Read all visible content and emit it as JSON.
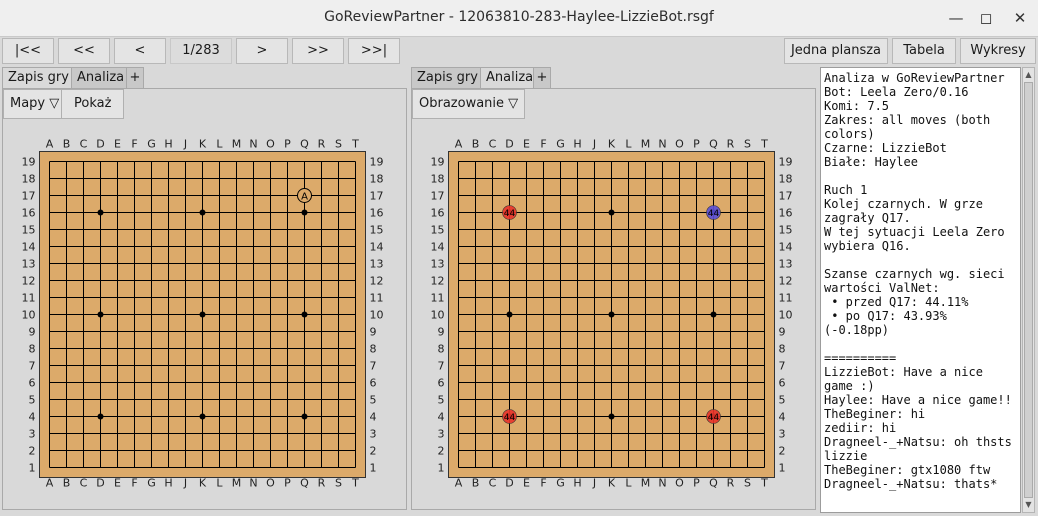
{
  "window": {
    "title": "GoReviewPartner - 12063810-283-Haylee-LizzieBot.rsgf",
    "minimize": "—",
    "maximize": "◻",
    "close": "✕"
  },
  "nav": {
    "first": "|<<",
    "prev10": "<<",
    "prev": "<",
    "counter": "1/283",
    "next": ">",
    "next10": ">>",
    "last": ">>|",
    "view_single": "Jedna plansza",
    "view_table": "Tabela",
    "view_charts": "Wykresy"
  },
  "left_panel": {
    "tabs": [
      "Zapis gry",
      "Analiza",
      "+"
    ],
    "active_tab": 0,
    "maps_button": "Mapy ▽",
    "show_button": "Pokaż"
  },
  "right_panel": {
    "tabs": [
      "Zapis gry",
      "Analiza",
      "+"
    ],
    "active_tab": 1,
    "display_button": "Obrazowanie ▽"
  },
  "board": {
    "size": 19,
    "col_labels": [
      "A",
      "B",
      "C",
      "D",
      "E",
      "F",
      "G",
      "H",
      "J",
      "K",
      "L",
      "M",
      "N",
      "O",
      "P",
      "Q",
      "R",
      "S",
      "T"
    ],
    "row_labels": [
      "19",
      "18",
      "17",
      "16",
      "15",
      "14",
      "13",
      "12",
      "11",
      "10",
      "9",
      "8",
      "7",
      "6",
      "5",
      "4",
      "3",
      "2",
      "1"
    ],
    "hoshi": [
      "D16",
      "K16",
      "Q16",
      "D10",
      "K10",
      "Q10",
      "D4",
      "K4",
      "Q4"
    ],
    "wood_color": "#dcaa6a",
    "line_color": "#000000"
  },
  "left_board": {
    "markers": [
      {
        "point": "Q17",
        "label": "A",
        "shape": "circle"
      }
    ]
  },
  "right_board": {
    "markers": [
      {
        "point": "D16",
        "label": "44",
        "color": "#e8332a"
      },
      {
        "point": "Q16",
        "label": "44",
        "color": "#5a4fd8"
      },
      {
        "point": "D4",
        "label": "44",
        "color": "#e8332a"
      },
      {
        "point": "Q4",
        "label": "44",
        "color": "#e8332a"
      }
    ]
  },
  "analysis_text": "Analiza w GoReviewPartner\nBot: Leela Zero/0.16\nKomi: 7.5\nZakres: all moves (both colors)\nCzarne: LizzieBot\nBiałe: Haylee\n\nRuch 1\nKolej czarnych. W grze zagrały Q17.\nW tej sytuacji Leela Zero wybiera Q16.\n\nSzanse czarnych wg. sieci wartości ValNet:\n • przed Q17: 44.11%\n • po Q17: 43.93% (-0.18pp)\n\n==========\nLizzieBot: Have a nice game :)\nHaylee: Have a nice game!!\nTheBeginer: hi\nzediir: hi\nDragneel-_+Natsu: oh thsts lizzie\nTheBeginer: gtx1080 ftw\nDragneel-_+Natsu: thats*"
}
